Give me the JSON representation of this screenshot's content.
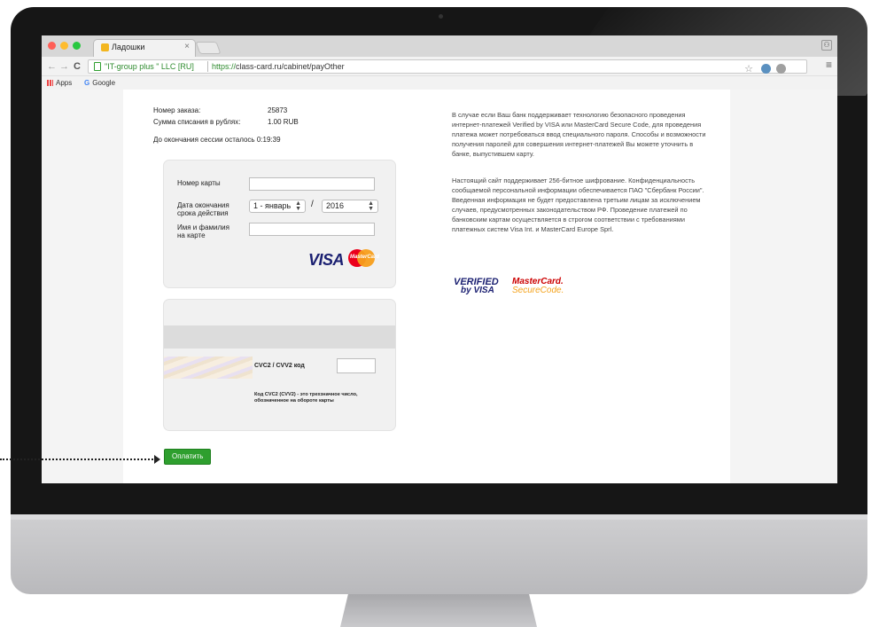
{
  "browser": {
    "tab_title": "Ладошки",
    "tab_close": "×",
    "ev_name": "\"IT-group plus \" LLC [RU]",
    "url_protocol": "https://",
    "url_rest": "class-card.ru/cabinet/payOther",
    "bookmarks": [
      "Apps",
      "Google"
    ],
    "nav": {
      "back": "←",
      "forward": "→",
      "reload": "C"
    },
    "star": "☆",
    "menu": "≡"
  },
  "order": {
    "number_label": "Номер заказа:",
    "number_value": "25873",
    "amount_label": "Сумма списания в рублях:",
    "amount_value": "1.00 RUB",
    "session_text": "До окончания сессии осталось 0:19:39"
  },
  "card_form": {
    "card_number_label": "Номер карты",
    "card_number_value": "",
    "expiry_label": "Дата окончания срока действия",
    "month_selected": "1 - январь",
    "year_selected": "2016",
    "separator": "/",
    "holder_label": "Имя и фамилия на карте",
    "holder_value": "",
    "brand_visa": "VISA",
    "brand_mastercard": "MasterCard",
    "cvc_label": "CVC2 / CVV2 код",
    "cvc_hint": "Код CVC2 (CVV2) - это трехзначное число, обозначенное на обороте карты",
    "pay_button": "Оплатить"
  },
  "info": {
    "paragraph1": "В случае если Ваш банк поддерживает технологию безопасного проведения интернет-платежей Verified by VISA или MasterCard Secure Code, для проведения платежа может потребоваться ввод специального пароля. Способы и возможности получения паролей для совершения интернет-платежей Вы можете уточнить в банке, выпустившем карту.",
    "paragraph2": "Настоящий сайт поддерживает 256-битное шифрование. Конфиденциальность сообщаемой персональной информации обеспечивается ПАО \"Сбербанк России\". Введенная информация не будет предоставлена третьим лицам за исключением случаев, предусмотренных законодательством РФ. Проведение платежей по банковским картам осуществляется в строгом соответствии с требованиями платежных систем Visa Int. и MasterCard Europe Sprl.",
    "verified_visa_line1": "VERIFIED",
    "verified_visa_line2": "by VISA",
    "securecode_line1": "MasterCard.",
    "securecode_line2": "SecureCode."
  },
  "colors": {
    "accent_green": "#2e9f2e",
    "visa_blue": "#1a1f71",
    "mastercard_red": "#eb001b",
    "mastercard_orange": "#f79e1b"
  },
  "icons": [
    "close-icon",
    "lock-icon",
    "star-icon",
    "menu-icon",
    "apps-icon",
    "google-icon",
    "mastercard-logo",
    "visa-logo"
  ]
}
